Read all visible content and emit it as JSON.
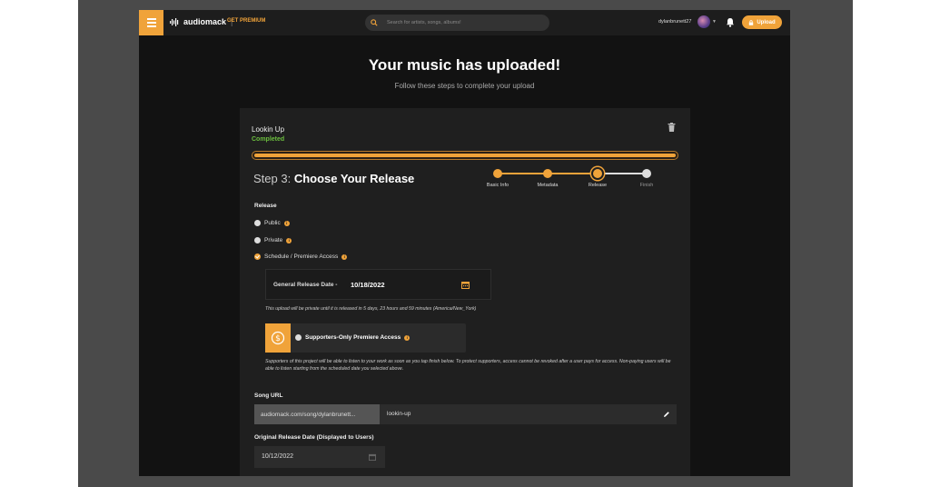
{
  "nav": {
    "logo_text": "audiomack",
    "premium_label": "GET PREMIUM",
    "search_placeholder": "Search for artists, songs, albums!",
    "username": "dylanbrunett27",
    "upload_label": "Upload"
  },
  "header": {
    "title": "Your music has uploaded!",
    "subtitle": "Follow these steps to complete your upload"
  },
  "track": {
    "name": "Lookin Up",
    "status": "Completed",
    "progress": 1.0
  },
  "step": {
    "prefix": "Step 3:",
    "title": "Choose Your Release"
  },
  "stepper": {
    "steps": [
      {
        "label": "Basic Info",
        "state": "done"
      },
      {
        "label": "Metadata",
        "state": "done"
      },
      {
        "label": "Release",
        "state": "active"
      },
      {
        "label": "Finish",
        "state": "pending"
      }
    ]
  },
  "release": {
    "heading": "Release",
    "options": [
      {
        "label": "Public",
        "checked": false
      },
      {
        "label": "Private",
        "checked": false
      },
      {
        "label": "Schedule / Premiere Access",
        "checked": true
      }
    ],
    "general_release_label": "General Release Date -",
    "general_release_date": "10/18/2022",
    "private_note": "This upload will be private until it is released in 5 days, 23 hours and 59 minutes (America/New_York)",
    "supporters_label": "Supporters-Only Premiere Access",
    "supporters_desc": "Supporters of this project will be able to listen to your work as soon as you tap finish below. To protect supporters, access cannot be revoked after a user pays for access. Non-paying users will be able to listen starting from the scheduled date you selected above."
  },
  "song_url": {
    "label": "Song URL",
    "prefix": "audiomack.com/song/dylanbrunett...",
    "slug": "lookin-up"
  },
  "original_release": {
    "label": "Original Release Date (Displayed to Users)",
    "date": "10/12/2022"
  },
  "colors": {
    "accent": "#f0a33a",
    "success": "#6bbd3e",
    "background": "#121212",
    "card": "#1f1f1f"
  }
}
